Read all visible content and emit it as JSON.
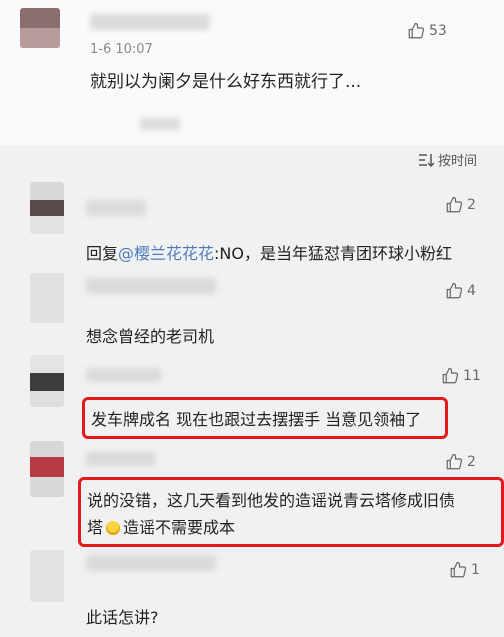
{
  "main_comment": {
    "time": "1-6 10:07",
    "likes": "53",
    "text": "就别以为阑夕是什么好东西就行了..."
  },
  "sort_label": "按时间",
  "replies": [
    {
      "likes": "2",
      "text_prefix": "回复",
      "mention": "@樱兰花花花",
      "text": ":NO，是当年猛怼青团环球小粉红"
    },
    {
      "likes": "4",
      "text": "想念曾经的老司机"
    },
    {
      "likes": "11",
      "text": "发车牌成名 现在也跟过去摆摆手 当意见领袖了"
    },
    {
      "likes": "2",
      "line1": "说的没错，这几天看到他发的造谣说青云塔修成旧债",
      "line2_a": "塔",
      "line2_b": "造谣不需要成本"
    },
    {
      "likes": "1",
      "text": "此话怎讲?"
    }
  ],
  "colors": {
    "highlight": "#e3191b",
    "mention": "#4e7bbd"
  }
}
